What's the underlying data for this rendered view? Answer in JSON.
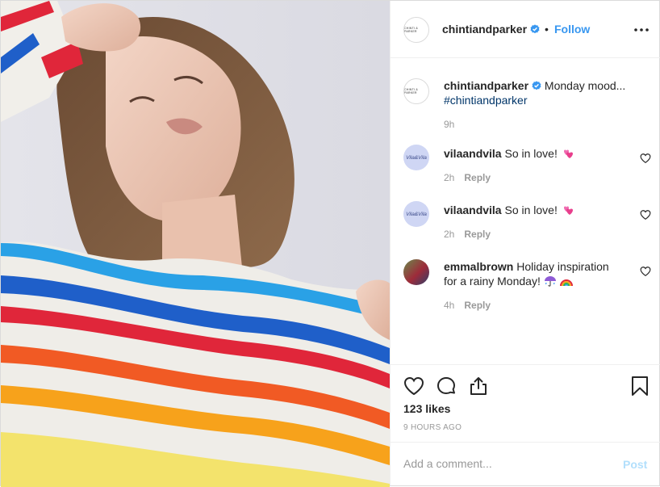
{
  "post": {
    "username": "chintiandparker",
    "brand_avatar_text": "CHINTI & PARKER",
    "follow_label": "Follow",
    "separator": "•",
    "caption": {
      "username": "chintiandparker",
      "text": "Monday mood...",
      "hashtag": "#chintiandparker",
      "time": "9h"
    },
    "comments": [
      {
        "username": "vilaandvila",
        "text": "So in love!",
        "emoji": "two-hearts",
        "time": "2h",
        "reply_label": "Reply",
        "avatar_text": "Vila&Vila"
      },
      {
        "username": "vilaandvila",
        "text": "So in love!",
        "emoji": "two-hearts",
        "time": "2h",
        "reply_label": "Reply",
        "avatar_text": "Vila&Vila"
      },
      {
        "username": "emmalbrown",
        "text_line1": "Holiday inspiration",
        "text_line2": "for a rainy Monday!",
        "emoji": "umbrella-rain, rainbow",
        "time": "4h",
        "reply_label": "Reply"
      }
    ],
    "likes": "123 likes",
    "timestamp": "9 HOURS AGO",
    "add_comment_placeholder": "Add a comment...",
    "post_button": "Post"
  },
  "colors": {
    "accent": "#3897f0",
    "verified": "#3897f0",
    "hashtag": "#003569",
    "muted": "#999999",
    "post_button_disabled": "#b2dffc"
  },
  "icons": [
    "verified-badge-icon",
    "more-options-icon",
    "heart-icon",
    "comment-icon",
    "share-icon",
    "bookmark-icon"
  ]
}
